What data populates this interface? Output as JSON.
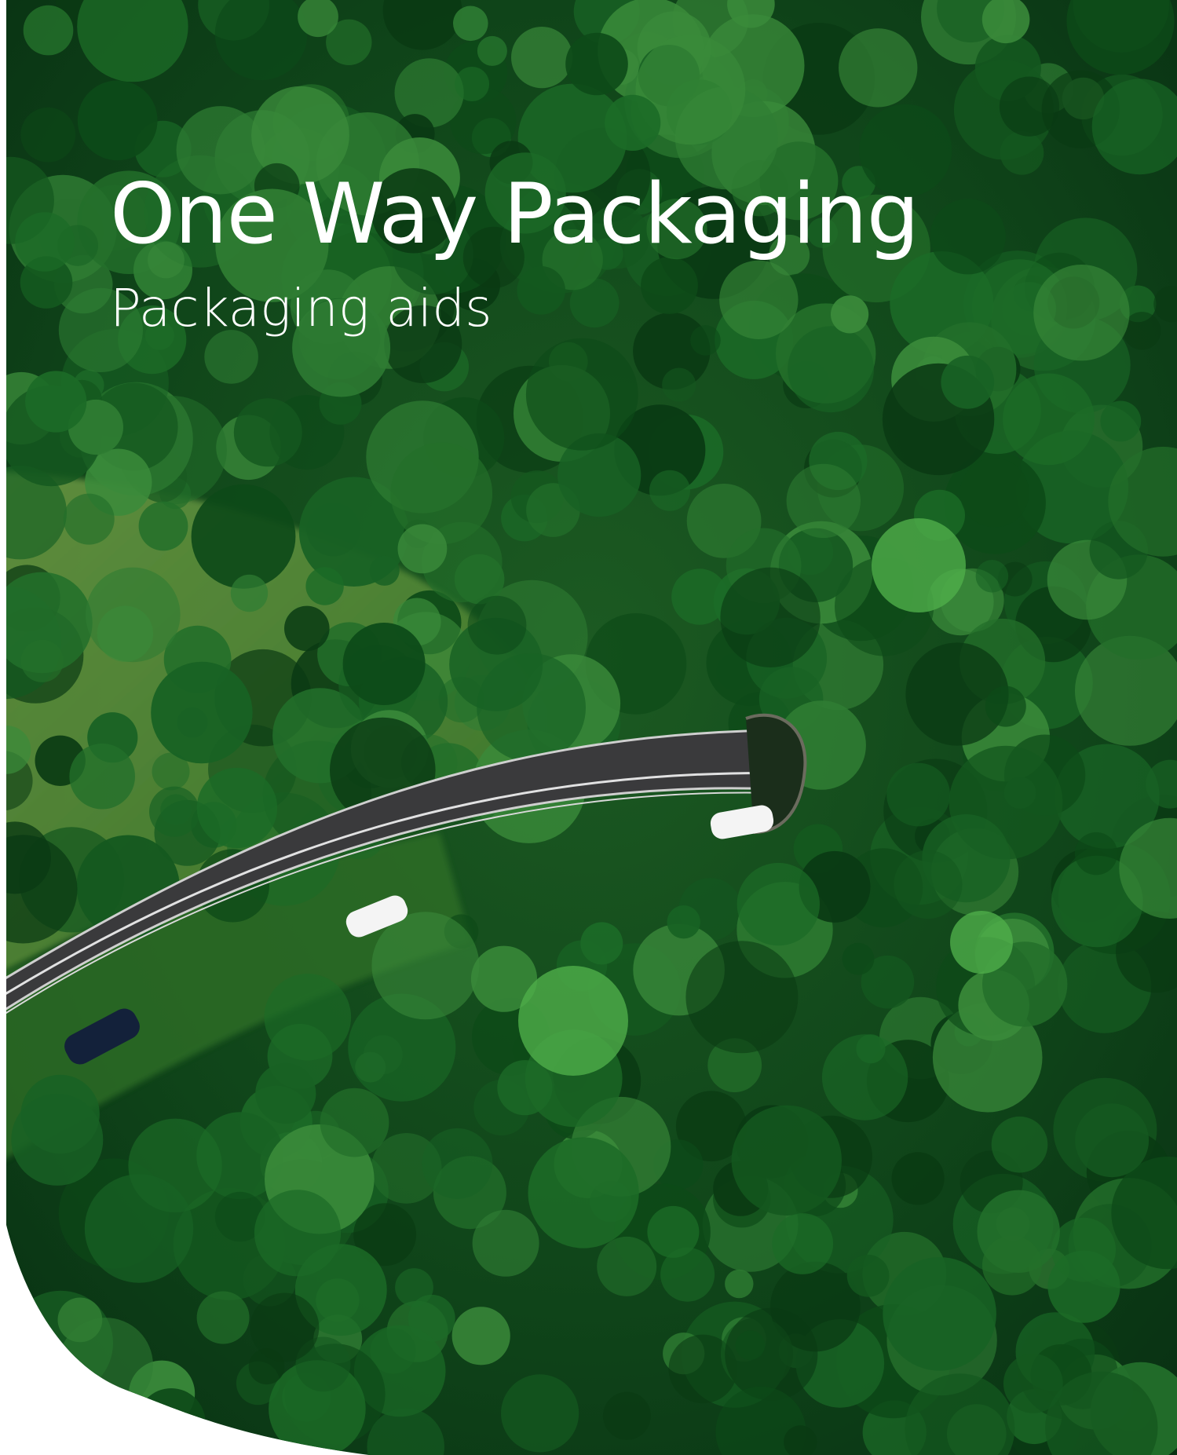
{
  "cover": {
    "title": "One Way Packaging",
    "subtitle": "Packaging aids",
    "colors": {
      "forest_dark": "#0b3d16",
      "forest_mid": "#1f6b2a",
      "forest_light": "#4d8f3a",
      "road": "#3a3a3c",
      "text": "#ffffff"
    }
  }
}
